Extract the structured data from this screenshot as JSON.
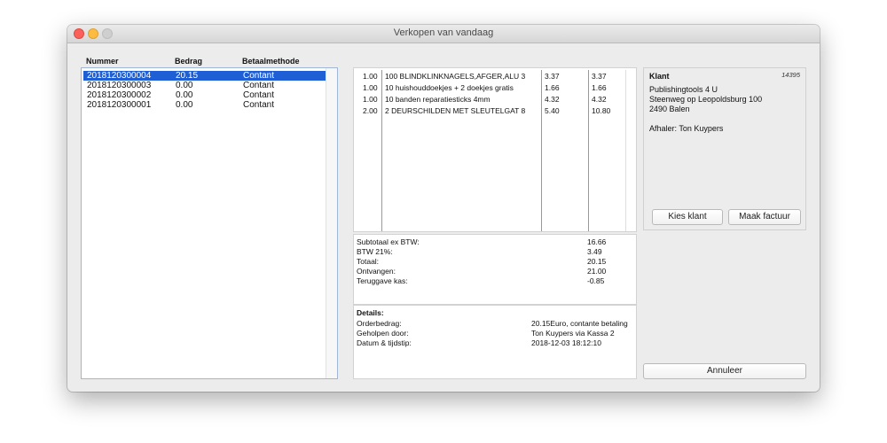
{
  "window": {
    "title": "Verkopen van vandaag"
  },
  "orders": {
    "headers": {
      "number": "Nummer",
      "amount": "Bedrag",
      "method": "Betaalmethode"
    },
    "rows": [
      {
        "number": "2018120300004",
        "amount": "20.15",
        "method": "Contant",
        "selected": true
      },
      {
        "number": "2018120300003",
        "amount": "0.00",
        "method": "Contant",
        "selected": false
      },
      {
        "number": "2018120300002",
        "amount": "0.00",
        "method": "Contant",
        "selected": false
      },
      {
        "number": "2018120300001",
        "amount": "0.00",
        "method": "Contant",
        "selected": false
      }
    ]
  },
  "items": [
    {
      "qty": "1.00",
      "desc": "100 BLINDKLINKNAGELS,AFGER,ALU 3",
      "price": "3.37",
      "total": "3.37"
    },
    {
      "qty": "1.00",
      "desc": "10 huishouddoekjes + 2 doekjes gratis",
      "price": "1.66",
      "total": "1.66"
    },
    {
      "qty": "1.00",
      "desc": "10 banden reparatiesticks 4mm",
      "price": "4.32",
      "total": "4.32"
    },
    {
      "qty": "2.00",
      "desc": "2 DEURSCHILDEN MET SLEUTELGAT 8",
      "price": "5.40",
      "total": "10.80"
    }
  ],
  "totals": [
    {
      "label": "Subtotaal ex BTW:",
      "value": "16.66"
    },
    {
      "label": "BTW 21%:",
      "value": "3.49"
    },
    {
      "label": "Totaal:",
      "value": "20.15"
    },
    {
      "label": "Ontvangen:",
      "value": "21.00"
    },
    {
      "label": "Teruggave kas:",
      "value": "-0.85"
    }
  ],
  "details": {
    "heading": "Details:",
    "rows": [
      {
        "label": "Orderbedrag:",
        "value": "20.15Euro, contante betaling"
      },
      {
        "label": "Geholpen door:",
        "value": "Ton Kuypers via Kassa 2"
      },
      {
        "label": "Datum & tijdstip:",
        "value": "2018-12-03 18:12:10"
      }
    ]
  },
  "customer": {
    "title": "Klant",
    "id": "14395",
    "name": "Publishingtools 4 U",
    "street": "Steenweg op Leopoldsburg 100",
    "city": "2490 Balen",
    "pickup": "Afhaler: Ton Kuypers",
    "choose_label": "Kies klant",
    "invoice_label": "Maak factuur"
  },
  "cancel_label": "Annuleer",
  "colors": {
    "selection": "#1f5fd6",
    "close": "#fc605b",
    "minimize": "#fdbc40"
  }
}
